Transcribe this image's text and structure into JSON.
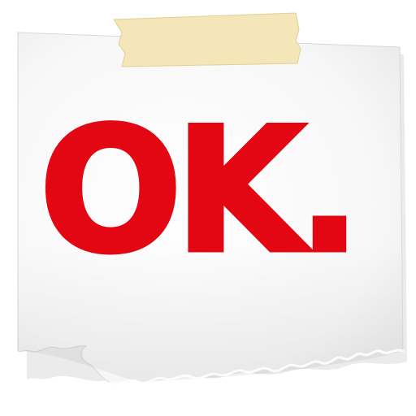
{
  "logo": {
    "text": "OK.",
    "color": "#e30613"
  },
  "note": {
    "paper_color": "#f6f6f6",
    "tape_color": "#f4e4b4"
  }
}
